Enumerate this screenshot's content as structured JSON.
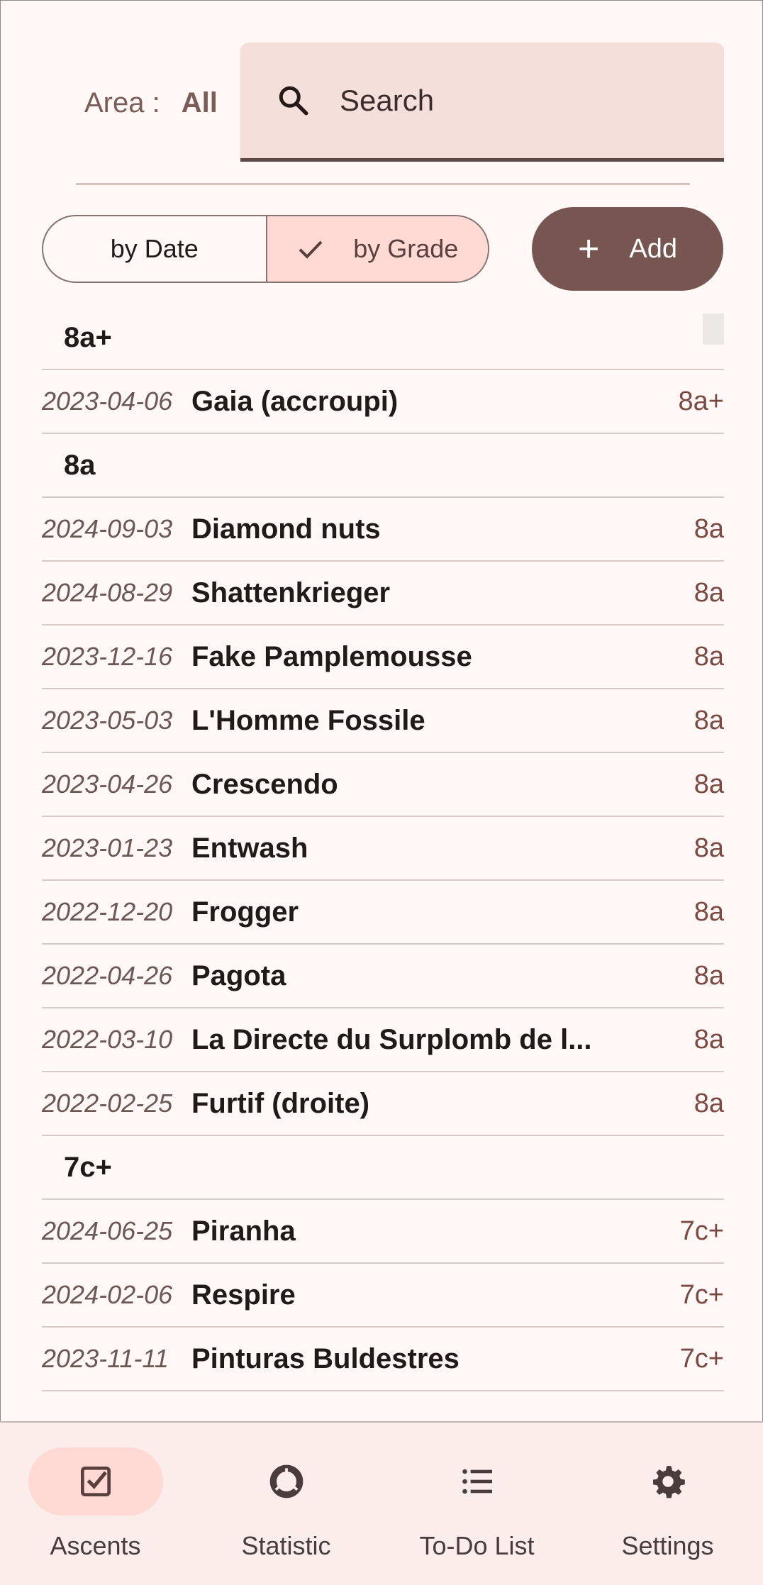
{
  "header": {
    "area_label": "Area :",
    "area_value": "All",
    "search_placeholder": "Search"
  },
  "sort": {
    "by_date": "by Date",
    "by_grade": "by Grade",
    "selected": "by Grade"
  },
  "add_button": "Add",
  "groups": [
    {
      "grade": "8a+",
      "items": [
        {
          "date": "2023-04-06",
          "name": "Gaia (accroupi)",
          "grade": "8a+"
        }
      ]
    },
    {
      "grade": "8a",
      "items": [
        {
          "date": "2024-09-03",
          "name": "Diamond nuts",
          "grade": "8a"
        },
        {
          "date": "2024-08-29",
          "name": "Shattenkrieger",
          "grade": "8a"
        },
        {
          "date": "2023-12-16",
          "name": "Fake Pamplemousse",
          "grade": "8a"
        },
        {
          "date": "2023-05-03",
          "name": "L'Homme Fossile",
          "grade": "8a"
        },
        {
          "date": "2023-04-26",
          "name": "Crescendo",
          "grade": "8a"
        },
        {
          "date": "2023-01-23",
          "name": "Entwash",
          "grade": "8a"
        },
        {
          "date": "2022-12-20",
          "name": "Frogger",
          "grade": "8a"
        },
        {
          "date": "2022-04-26",
          "name": "Pagota",
          "grade": "8a"
        },
        {
          "date": "2022-03-10",
          "name": "La Directe du Surplomb de l...",
          "grade": "8a"
        },
        {
          "date": "2022-02-25",
          "name": "Furtif (droite)",
          "grade": "8a"
        }
      ]
    },
    {
      "grade": "7c+",
      "items": [
        {
          "date": "2024-06-25",
          "name": "Piranha",
          "grade": "7c+"
        },
        {
          "date": "2024-02-06",
          "name": "Respire",
          "grade": "7c+"
        },
        {
          "date": "2023-11-11",
          "name": "Pinturas Buldestres",
          "grade": "7c+"
        }
      ]
    }
  ],
  "nav": [
    {
      "label": "Ascents",
      "icon": "checkbox-icon",
      "active": true
    },
    {
      "label": "Statistic",
      "icon": "donut-chart-icon",
      "active": false
    },
    {
      "label": "To-Do List",
      "icon": "list-icon",
      "active": false
    },
    {
      "label": "Settings",
      "icon": "gear-icon",
      "active": false
    }
  ],
  "colors": {
    "background": "#FFF8F6",
    "accent": "#775651",
    "selected": "#FFDAD5",
    "grade_text": "#7a4a43"
  }
}
